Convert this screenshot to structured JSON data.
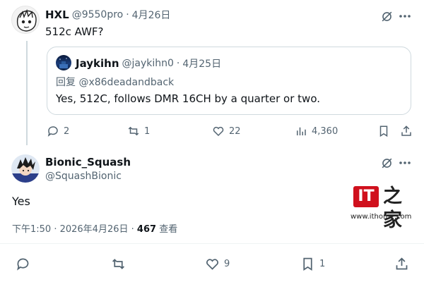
{
  "reply_tweet": {
    "display_name": "HXL",
    "handle": "@9550pro",
    "separator": "·",
    "date": "4月26日",
    "text": "512c AWF?",
    "quote": {
      "display_name": "Jaykihn",
      "handle": "@jaykihn0",
      "separator": "·",
      "date": "4月25日",
      "reply_prefix": "回复",
      "reply_to": "@x86deadandback",
      "text": "Yes, 512C, follows DMR 16CH by a quarter or two."
    },
    "metrics": {
      "replies": "2",
      "reposts": "1",
      "likes": "22",
      "views": "4,360"
    }
  },
  "main_tweet": {
    "display_name": "Bionic_Squash",
    "handle": "@SquashBionic",
    "text": "Yes",
    "timestamp": "下午1:50 · 2026年4月26日 ·",
    "views_count": "467",
    "views_label": "查看",
    "metrics": {
      "likes": "9",
      "bookmarks": "1"
    }
  },
  "watermark": {
    "logo_text": "IT之家",
    "url": "www.ithome.com"
  },
  "colors": {
    "text": "#0f1419",
    "muted": "#536471",
    "link": "#1d9bf0",
    "border": "#cfd9de",
    "brand_red": "#d0101d"
  },
  "icons": [
    "grok-icon",
    "more-icon",
    "reply-icon",
    "repost-icon",
    "like-icon",
    "views-icon",
    "bookmark-icon",
    "share-icon"
  ]
}
